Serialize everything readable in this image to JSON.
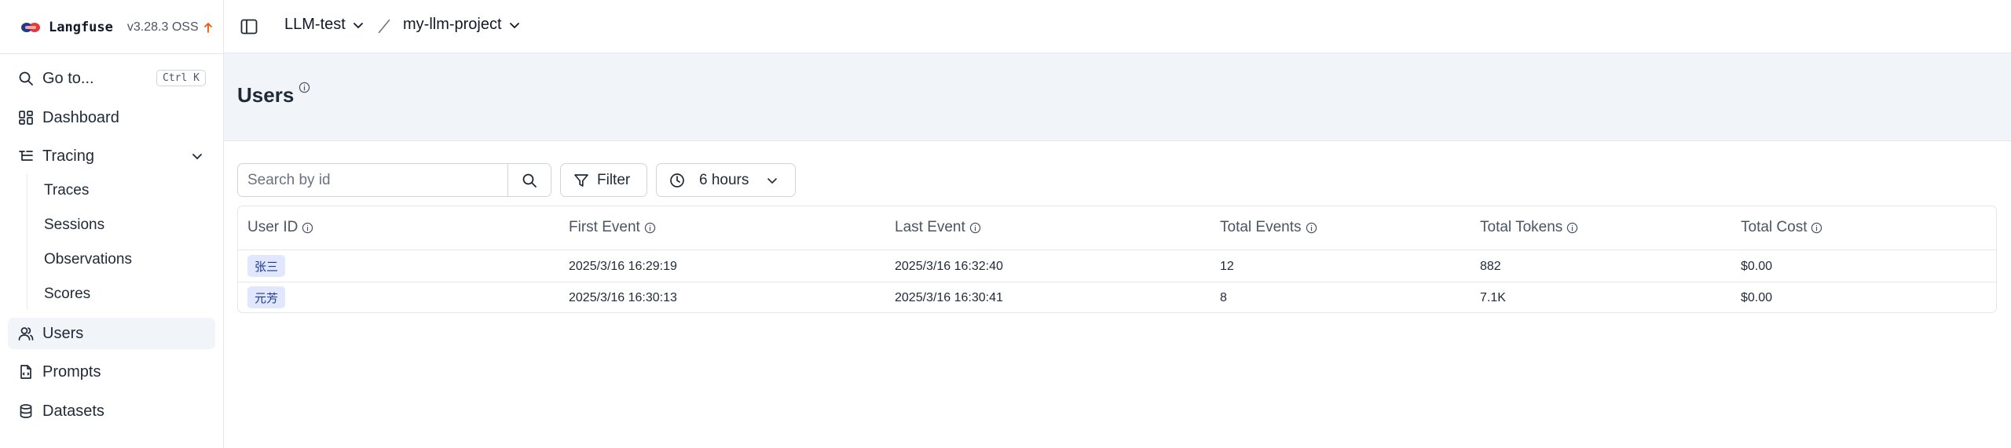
{
  "brand": {
    "name": "Langfuse",
    "version": "v3.28.3 OSS",
    "update_icon": "arrow-up-icon"
  },
  "sidebar": {
    "goto": {
      "label": "Go to...",
      "shortcut": "Ctrl K"
    },
    "items": [
      {
        "label": "Dashboard",
        "icon": "dashboard-icon"
      },
      {
        "label": "Tracing",
        "icon": "tracing-icon"
      },
      {
        "label": "Users",
        "icon": "users-icon",
        "active": true
      },
      {
        "label": "Prompts",
        "icon": "prompts-icon"
      },
      {
        "label": "Datasets",
        "icon": "datasets-icon"
      }
    ],
    "tracing_sub": [
      "Traces",
      "Sessions",
      "Observations",
      "Scores"
    ]
  },
  "topbar": {
    "org": "LLM-test",
    "project": "my-llm-project"
  },
  "page": {
    "title": "Users"
  },
  "toolbar": {
    "search_placeholder": "Search by id",
    "filter_label": "Filter",
    "time_range": "6 hours"
  },
  "table": {
    "columns": [
      "User ID",
      "First Event",
      "Last Event",
      "Total Events",
      "Total Tokens",
      "Total Cost"
    ],
    "rows": [
      {
        "user_id": "张三",
        "first_event": "2025/3/16 16:29:19",
        "last_event": "2025/3/16 16:32:40",
        "total_events": "12",
        "total_tokens": "882",
        "total_cost": "$0.00"
      },
      {
        "user_id": "元芳",
        "first_event": "2025/3/16 16:30:13",
        "last_event": "2025/3/16 16:30:41",
        "total_events": "8",
        "total_tokens": "7.1K",
        "total_cost": "$0.00"
      }
    ]
  },
  "colors": {
    "accent_tag": "#e0e7ff",
    "header_band": "#f1f5f9",
    "update_arrow": "#ea580c"
  }
}
